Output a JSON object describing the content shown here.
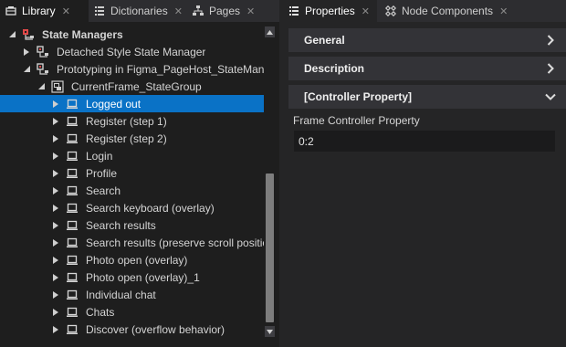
{
  "left_tabs": [
    {
      "label": "Library",
      "icon": "library-icon",
      "active": true
    },
    {
      "label": "Dictionaries",
      "icon": "list-icon",
      "active": false
    },
    {
      "label": "Pages",
      "icon": "sitemap-icon",
      "active": false
    }
  ],
  "tree": [
    {
      "label": "State Managers",
      "indent": 0,
      "expander": "expanded",
      "icon": "state-manager-folder-icon",
      "selected": false,
      "bold": true
    },
    {
      "label": "Detached Style State Manager",
      "indent": 1,
      "expander": "collapsed",
      "icon": "state-manager-icon",
      "selected": false
    },
    {
      "label": "Prototyping in Figma_PageHost_StateManager",
      "indent": 1,
      "expander": "expanded",
      "icon": "state-manager-icon",
      "selected": false
    },
    {
      "label": "CurrentFrame_StateGroup",
      "indent": 2,
      "expander": "expanded",
      "icon": "state-group-icon",
      "selected": false
    },
    {
      "label": "Logged out",
      "indent": 3,
      "expander": "collapsed",
      "icon": "state-icon",
      "selected": true
    },
    {
      "label": "Register (step 1)",
      "indent": 3,
      "expander": "collapsed",
      "icon": "state-icon",
      "selected": false
    },
    {
      "label": "Register (step 2)",
      "indent": 3,
      "expander": "collapsed",
      "icon": "state-icon",
      "selected": false
    },
    {
      "label": "Login",
      "indent": 3,
      "expander": "collapsed",
      "icon": "state-icon",
      "selected": false
    },
    {
      "label": "Profile",
      "indent": 3,
      "expander": "collapsed",
      "icon": "state-icon",
      "selected": false
    },
    {
      "label": "Search",
      "indent": 3,
      "expander": "collapsed",
      "icon": "state-icon",
      "selected": false
    },
    {
      "label": "Search keyboard (overlay)",
      "indent": 3,
      "expander": "collapsed",
      "icon": "state-icon",
      "selected": false
    },
    {
      "label": "Search results",
      "indent": 3,
      "expander": "collapsed",
      "icon": "state-icon",
      "selected": false
    },
    {
      "label": "Search results (preserve scroll position)",
      "indent": 3,
      "expander": "collapsed",
      "icon": "state-icon",
      "selected": false
    },
    {
      "label": "Photo open (overlay)",
      "indent": 3,
      "expander": "collapsed",
      "icon": "state-icon",
      "selected": false
    },
    {
      "label": "Photo open (overlay)_1",
      "indent": 3,
      "expander": "collapsed",
      "icon": "state-icon",
      "selected": false
    },
    {
      "label": "Individual chat",
      "indent": 3,
      "expander": "collapsed",
      "icon": "state-icon",
      "selected": false
    },
    {
      "label": "Chats",
      "indent": 3,
      "expander": "collapsed",
      "icon": "state-icon",
      "selected": false
    },
    {
      "label": "Discover (overflow behavior)",
      "indent": 3,
      "expander": "collapsed",
      "icon": "state-icon",
      "selected": false
    }
  ],
  "scrollbar": {
    "thumb_start": 0.47,
    "thumb_end": 0.99
  },
  "right_tabs": [
    {
      "label": "Properties",
      "icon": "list-icon",
      "active": true
    },
    {
      "label": "Node Components",
      "icon": "components-icon",
      "active": false
    }
  ],
  "sections": [
    {
      "label": "General",
      "expanded": false
    },
    {
      "label": "Description",
      "expanded": false
    },
    {
      "label": "[Controller Property]",
      "expanded": true
    }
  ],
  "property": {
    "label": "Frame Controller Property",
    "value": "0:2"
  },
  "colors": {
    "selection": "#0a72c6",
    "panel": "#1e1e1e",
    "section": "#333337",
    "state_manager_icon": "#e04848"
  }
}
